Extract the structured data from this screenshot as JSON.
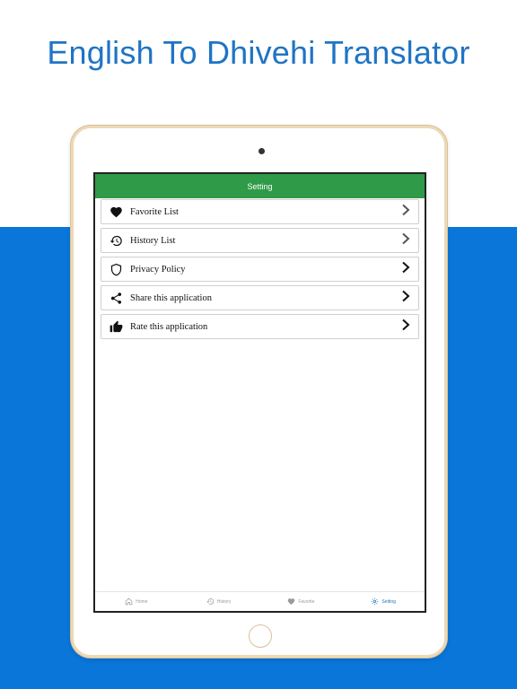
{
  "promo": {
    "title": "English To Dhivehi Translator",
    "accent_color": "#1f74c4",
    "band_color": "#0a76da"
  },
  "app": {
    "header_title": "Setting",
    "header_color": "#2f9a47",
    "settings_items": [
      {
        "label": "Favorite List",
        "icon": "heart-icon"
      },
      {
        "label": "History List",
        "icon": "history-icon"
      },
      {
        "label": "Privacy Policy",
        "icon": "shield-icon"
      },
      {
        "label": "Share this application",
        "icon": "share-icon"
      },
      {
        "label": "Rate this application",
        "icon": "thumbs-up-icon"
      }
    ],
    "bottom_nav": [
      {
        "label": "Home",
        "icon": "home-icon",
        "active": false
      },
      {
        "label": "History",
        "icon": "history-icon",
        "active": false
      },
      {
        "label": "Favorite",
        "icon": "heart-icon",
        "active": false
      },
      {
        "label": "Setting",
        "icon": "gear-icon",
        "active": true
      }
    ]
  }
}
